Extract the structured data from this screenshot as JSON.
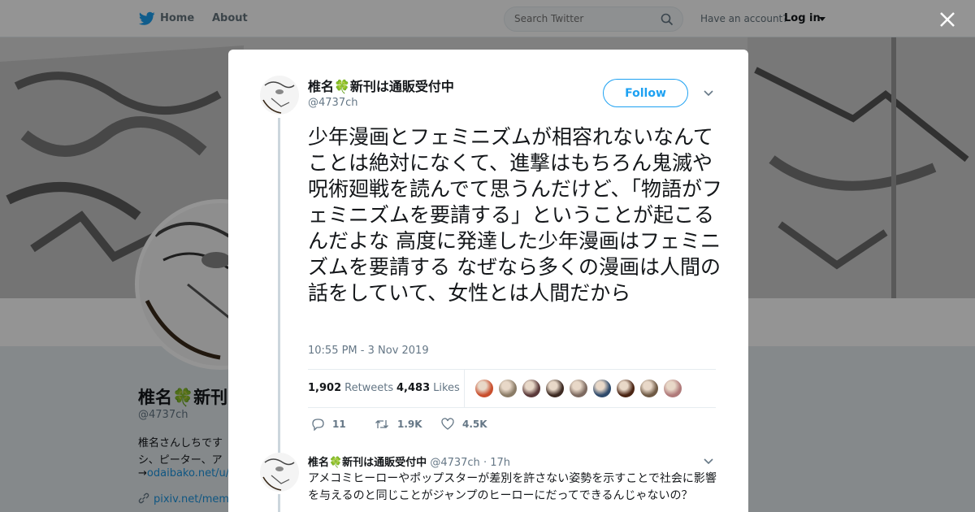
{
  "nav": {
    "home_label": "Home",
    "about_label": "About",
    "search_placeholder": "Search Twitter",
    "have_account": "Have an account?",
    "login_label": "Log in"
  },
  "profile": {
    "name": "椎名🍀新刊",
    "handle": "@4737ch",
    "bio_line1": "椎名さんしちです",
    "bio_line2": "シ、ピーター、ア",
    "bio_line3_prefix": "→",
    "bio_line3_link": "odaibako.net/u/",
    "website": "pixiv.net/mem"
  },
  "tweet": {
    "author_name": "椎名🍀新刊は通販受付中",
    "author_handle": "@4737ch",
    "follow_label": "Follow",
    "text": "少年漫画とフェミニズムが相容れないなんてことは絶対になくて、進撃はもちろん鬼滅や呪術廻戦を読んでて思うんだけど、「物語がフェミニズムを要請する」ということが起こるんだよな 高度に発達した少年漫画はフェミニズムを要請する なぜなら多くの漫画は人間の話をしていて、女性とは人間だから",
    "timestamp": "10:55 PM - 3 Nov 2019",
    "retweets_count": "1,902",
    "retweets_label": "Retweets",
    "likes_count": "4,483",
    "likes_label": "Likes",
    "replies_action": "11",
    "retweets_action": "1.9K",
    "likes_action": "4.5K"
  },
  "reply": {
    "author_name": "椎名🍀新刊は通販受付中",
    "author_handle": "@4737ch",
    "separator": "·",
    "time": "17h",
    "text": "アメコミヒーローやポップスターが差別を許さない姿勢を示すことで社会に影響を与えるのと同じことがジャンプのヒーローにだってできるんじゃないの？"
  },
  "colors": {
    "accent": "#1da1f2",
    "link": "#1b95e0",
    "muted": "#657786",
    "text": "#14171a"
  },
  "liker_colors": [
    "#c94f2e",
    "#8a7b66",
    "#5b3a3a",
    "#3d2a22",
    "#7d6a60",
    "#2f4a6b",
    "#4a2413",
    "#6f5a45",
    "#b07a7a"
  ]
}
